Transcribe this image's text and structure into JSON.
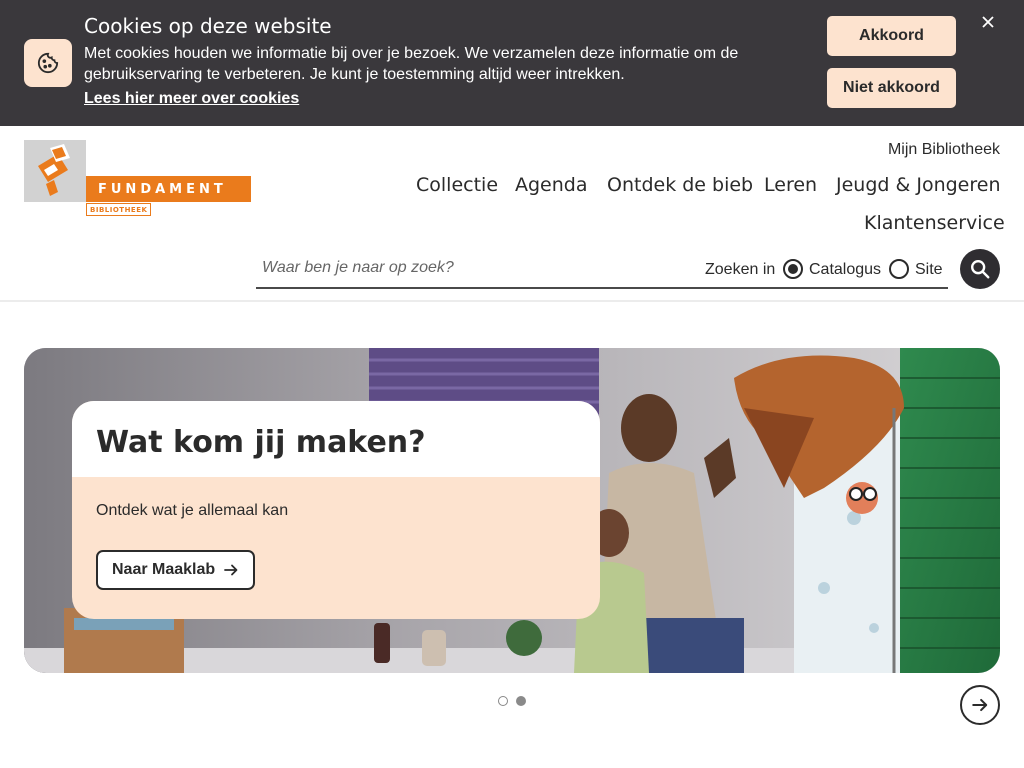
{
  "cookie": {
    "title": "Cookies op deze website",
    "text": "Met cookies houden we informatie bij over je bezoek. We verzamelen deze informatie om de gebruikservaring te verbeteren. Je kunt je toestemming altijd weer intrekken.",
    "link": "Lees hier meer over cookies",
    "accept": "Akkoord",
    "decline": "Niet akkoord",
    "close": "×",
    "icon": "cookie-icon"
  },
  "logo": {
    "name": "FUNDAMENT",
    "sub": "BIBLIOTHEEK",
    "brand_color": "#ea7b1c"
  },
  "header": {
    "account": "Mijn Bibliotheek",
    "nav": [
      "Collectie",
      "Agenda",
      "Ontdek de bieb",
      "Leren",
      "Jeugd & Jongeren",
      "Klantenservice"
    ]
  },
  "search": {
    "placeholder": "Waar ben je naar op zoek?",
    "scope_label": "Zoeken in",
    "options": [
      "Catalogus",
      "Site"
    ],
    "selected": "Catalogus",
    "icon": "search-icon"
  },
  "hero": {
    "title": "Wat kom jij maken?",
    "text": "Ontdek wat je allemaal kan",
    "button": "Naar Maaklab",
    "card_color": "#fde3cf"
  },
  "carousel": {
    "slides": 2,
    "active": 1,
    "next_icon": "arrow-right-icon"
  },
  "colors": {
    "cookie_bar": "#3a383c",
    "accent_peach": "#fde3cf",
    "dark": "#2f2d31"
  }
}
